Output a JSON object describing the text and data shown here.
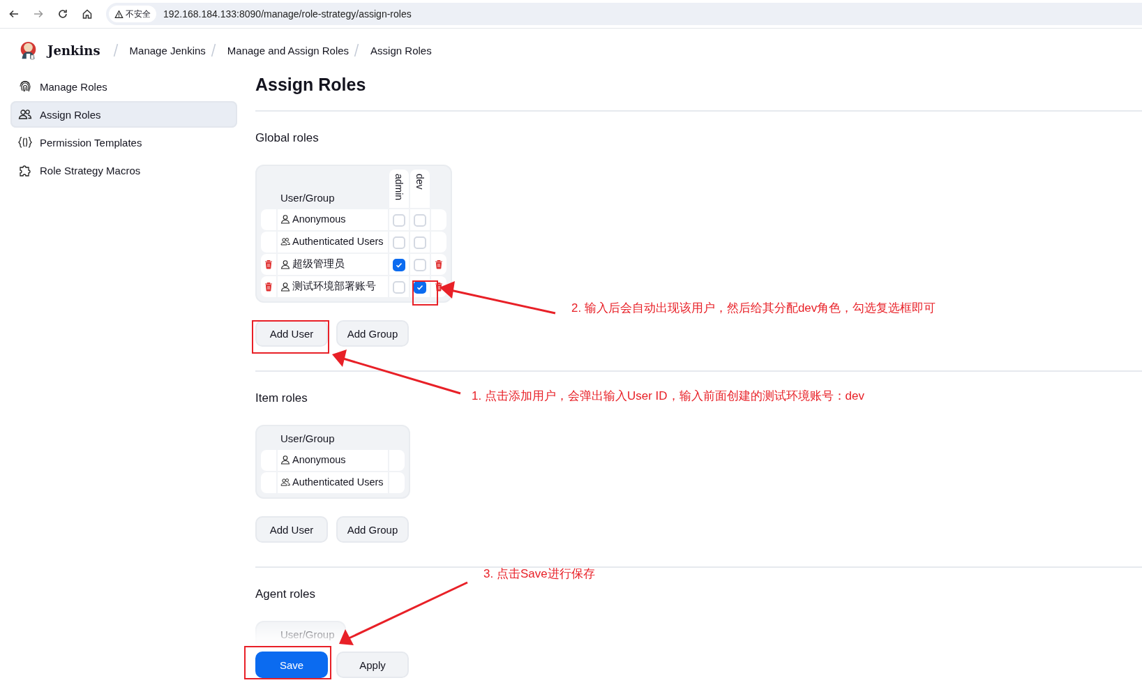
{
  "browser": {
    "security_label": "不安全",
    "url": "192.168.184.133:8090/manage/role-strategy/assign-roles"
  },
  "header": {
    "brand": "Jenkins",
    "breadcrumbs": [
      "Manage Jenkins",
      "Manage and Assign Roles",
      "Assign Roles"
    ]
  },
  "sidebar": {
    "items": [
      {
        "label": "Manage Roles",
        "kind": "fingerprint",
        "selected": false
      },
      {
        "label": "Assign Roles",
        "kind": "people",
        "selected": true
      },
      {
        "label": "Permission Templates",
        "kind": "braces",
        "selected": false
      },
      {
        "label": "Role Strategy Macros",
        "kind": "puzzle",
        "selected": false
      }
    ]
  },
  "page_title": "Assign Roles",
  "sections": [
    {
      "title": "Global roles",
      "table": {
        "header": "User/Group",
        "roles": [
          "admin",
          "dev"
        ],
        "rows": [
          {
            "name": "Anonymous",
            "kind": "user",
            "removable": false,
            "checks": [
              false,
              false
            ]
          },
          {
            "name": "Authenticated Users",
            "kind": "group",
            "removable": false,
            "checks": [
              false,
              false
            ]
          },
          {
            "name": "超级管理员",
            "kind": "user",
            "removable": true,
            "checks": [
              true,
              false
            ]
          },
          {
            "name": "测试环境部署账号",
            "kind": "user",
            "removable": true,
            "checks": [
              false,
              true
            ]
          }
        ]
      },
      "buttons": [
        "Add User",
        "Add Group"
      ]
    },
    {
      "title": "Item roles",
      "table": {
        "header": "User/Group",
        "rows": [
          {
            "name": "Anonymous",
            "kind": "user",
            "removable": false
          },
          {
            "name": "Authenticated Users",
            "kind": "group",
            "removable": false
          }
        ]
      },
      "buttons": [
        "Add User",
        "Add Group"
      ]
    },
    {
      "title": "Agent roles",
      "table": {
        "header": "User/Group"
      }
    }
  ],
  "footer_buttons": [
    {
      "label": "Save",
      "kind": "primary"
    },
    {
      "label": "Apply",
      "kind": "secondary"
    }
  ],
  "annotations": [
    "1. 点击添加用户，会弹出输入User ID，输入前面创建的测试环境账号：dev",
    "2. 输入后会自动出现该用户，然后给其分配dev角色，勾选复选框即可",
    "3. 点击Save进行保存"
  ]
}
